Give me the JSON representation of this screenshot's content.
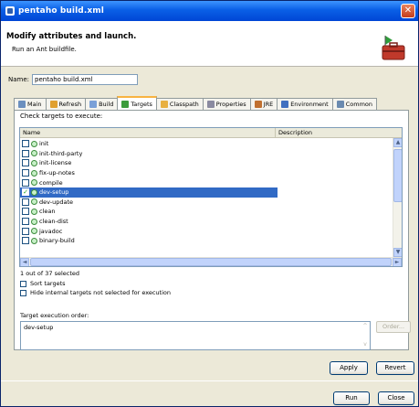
{
  "window": {
    "title": "pentaho build.xml",
    "close_symbol": "✕"
  },
  "header": {
    "title": "Modify attributes and launch.",
    "subtitle": "Run an Ant buildfile."
  },
  "name_field": {
    "label": "Name:",
    "value": "pentaho build.xml"
  },
  "tabs": [
    {
      "label": "Main",
      "icon": "main-tab-icon",
      "color": "#6b8fbf"
    },
    {
      "label": "Refresh",
      "icon": "refresh-icon",
      "color": "#e0a030"
    },
    {
      "label": "Build",
      "icon": "build-icon",
      "color": "#7aa0d8"
    },
    {
      "label": "Targets",
      "icon": "targets-icon",
      "color": "#3c9c3c"
    },
    {
      "label": "Classpath",
      "icon": "classpath-icon",
      "color": "#e8b040"
    },
    {
      "label": "Properties",
      "icon": "properties-icon",
      "color": "#8a8aa0"
    },
    {
      "label": "JRE",
      "icon": "jre-icon",
      "color": "#c07030"
    },
    {
      "label": "Environment",
      "icon": "environment-icon",
      "color": "#4070c0"
    },
    {
      "label": "Common",
      "icon": "common-icon",
      "color": "#6a8ab0"
    }
  ],
  "targets": {
    "instruction": "Check targets to execute:",
    "columns": {
      "name": "Name",
      "description": "Description"
    },
    "rows": [
      {
        "name": "init",
        "checked": false,
        "selected": false
      },
      {
        "name": "init-third-party",
        "checked": false,
        "selected": false
      },
      {
        "name": "init-license",
        "checked": false,
        "selected": false
      },
      {
        "name": "fix-up-notes",
        "checked": false,
        "selected": false
      },
      {
        "name": "compile",
        "checked": false,
        "selected": false
      },
      {
        "name": "dev-setup",
        "checked": true,
        "selected": true
      },
      {
        "name": "dev-update",
        "checked": false,
        "selected": false
      },
      {
        "name": "clean",
        "checked": false,
        "selected": false
      },
      {
        "name": "clean-dist",
        "checked": false,
        "selected": false
      },
      {
        "name": "javadoc",
        "checked": false,
        "selected": false
      },
      {
        "name": "binary-build",
        "checked": false,
        "selected": false
      }
    ],
    "selection_count": "1 out of 37 selected",
    "sort_targets_label": "Sort targets",
    "hide_internal_label": "Hide internal targets not selected for execution"
  },
  "execution_order": {
    "label": "Target execution order:",
    "value": "dev-setup",
    "order_button": "Order..."
  },
  "buttons": {
    "apply": "Apply",
    "revert": "Revert",
    "run": "Run",
    "close": "Close"
  },
  "scroll_arrows": {
    "up": "▲",
    "down": "▼",
    "left": "◄",
    "right": "►",
    "up_disabled": "^",
    "down_disabled": "v"
  },
  "checkmark": "✓"
}
